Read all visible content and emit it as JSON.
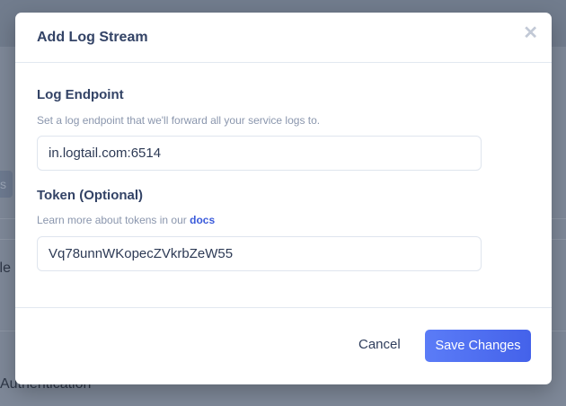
{
  "background": {
    "button_fragment": "s",
    "text_fragment": "ile",
    "section_fragment": "Authentication"
  },
  "modal": {
    "title": "Add Log Stream",
    "close_icon": "close-icon",
    "endpoint": {
      "label": "Log Endpoint",
      "help": "Set a log endpoint that we'll forward all your service logs to.",
      "value": "in.logtail.com:6514"
    },
    "token": {
      "label": "Token (Optional)",
      "help": "Learn more about tokens in our ",
      "help_link": "docs",
      "value": "Vq78unnWKopecZVkrbZeW55"
    },
    "cancel_label": "Cancel",
    "save_label": "Save Changes"
  }
}
